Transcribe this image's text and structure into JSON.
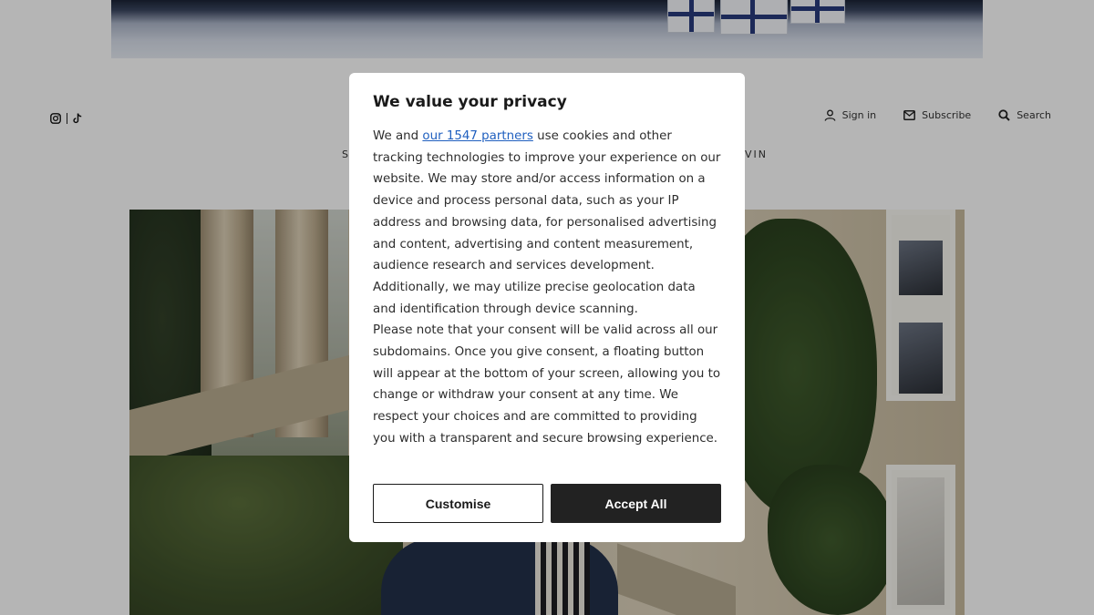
{
  "header": {
    "social_icons": [
      "instagram-icon",
      "tiktok-icon"
    ],
    "sign_in_label": "Sign in",
    "subscribe_label": "Subscribe",
    "search_label": "Search",
    "nav_peek_left": "S",
    "nav_peek_right": "VIN"
  },
  "consent": {
    "title": "We value your privacy",
    "intro_before_link": "We and ",
    "partners_link": "our 1547 partners",
    "intro_after_link": " use cookies and other tracking technologies to improve your experience on our website. We may store and/or access information on a device and process personal data, such as your IP address and browsing data, for personalised advertising and content, advertising and content measurement, audience research and services development. Additionally, we may utilize precise geolocation data and identification through device scanning.",
    "note": "Please note that your consent will be valid across all our subdomains. Once you give consent, a floating button will appear at the bottom of your screen, allowing you to change or withdraw your consent at any time. We respect your choices and are committed to providing you with a transparent and secure browsing experience.",
    "customise_label": "Customise",
    "accept_label": "Accept All"
  },
  "colors": {
    "accent_link": "#1f5fbf",
    "accept_button_bg": "#222222",
    "overlay": "rgba(0,0,0,0.28)"
  }
}
